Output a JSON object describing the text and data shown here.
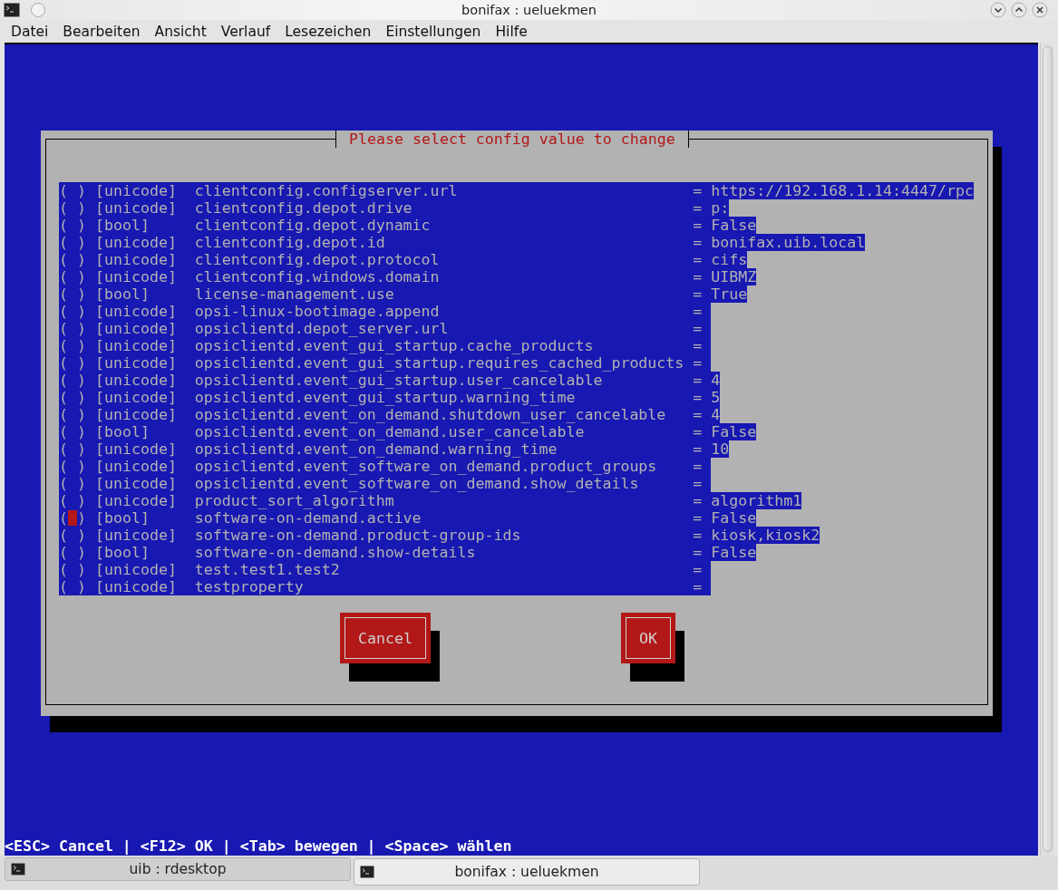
{
  "window": {
    "title": "bonifax : ueluekmen"
  },
  "menu": [
    "Datei",
    "Bearbeiten",
    "Ansicht",
    "Verlauf",
    "Lesezeichen",
    "Einstellungen",
    "Hilfe"
  ],
  "dialog": {
    "title": "Please select config value to change",
    "rows": [
      {
        "radio": "( )",
        "type": "[unicode]",
        "name": "clientconfig.configserver.url",
        "separator": "=",
        "value": "https://192.168.1.14:4447/rpc",
        "checked": false,
        "focused": false
      },
      {
        "radio": "( )",
        "type": "[unicode]",
        "name": "clientconfig.depot.drive",
        "separator": "=",
        "value": "p:",
        "checked": false,
        "focused": false
      },
      {
        "radio": "( )",
        "type": "[bool]",
        "name": "clientconfig.depot.dynamic",
        "separator": "=",
        "value": "False",
        "checked": false,
        "focused": false
      },
      {
        "radio": "( )",
        "type": "[unicode]",
        "name": "clientconfig.depot.id",
        "separator": "=",
        "value": "bonifax.uib.local",
        "checked": false,
        "focused": false
      },
      {
        "radio": "( )",
        "type": "[unicode]",
        "name": "clientconfig.depot.protocol",
        "separator": "=",
        "value": "cifs",
        "checked": false,
        "focused": false
      },
      {
        "radio": "( )",
        "type": "[unicode]",
        "name": "clientconfig.windows.domain",
        "separator": "=",
        "value": "UIBMZ",
        "checked": false,
        "focused": false
      },
      {
        "radio": "( )",
        "type": "[bool]",
        "name": "license-management.use",
        "separator": "=",
        "value": "True",
        "checked": false,
        "focused": false
      },
      {
        "radio": "( )",
        "type": "[unicode]",
        "name": "opsi-linux-bootimage.append",
        "separator": "=",
        "checked": false,
        "focused": false
      },
      {
        "radio": "( )",
        "type": "[unicode]",
        "name": "opsiclientd.depot_server.url",
        "separator": "=",
        "checked": false,
        "focused": false
      },
      {
        "radio": "( )",
        "type": "[unicode]",
        "name": "opsiclientd.event_gui_startup.cache_products",
        "separator": "=",
        "checked": false,
        "focused": false
      },
      {
        "radio": "( )",
        "type": "[unicode]",
        "name": "opsiclientd.event_gui_startup.requires_cached_products",
        "separator": "=",
        "checked": false,
        "focused": false
      },
      {
        "radio": "( )",
        "type": "[unicode]",
        "name": "opsiclientd.event_gui_startup.user_cancelable",
        "separator": "=",
        "value": "4",
        "checked": false,
        "focused": false
      },
      {
        "radio": "( )",
        "type": "[unicode]",
        "name": "opsiclientd.event_gui_startup.warning_time",
        "separator": "=",
        "value": "5",
        "checked": false,
        "focused": false
      },
      {
        "radio": "( )",
        "type": "[unicode]",
        "name": "opsiclientd.event_on_demand.shutdown_user_cancelable",
        "separator": "=",
        "value": "4",
        "checked": false,
        "focused": false
      },
      {
        "radio": "( )",
        "type": "[bool]",
        "name": "opsiclientd.event_on_demand.user_cancelable",
        "separator": "=",
        "value": "False",
        "checked": false,
        "focused": false
      },
      {
        "radio": "( )",
        "type": "[unicode]",
        "name": "opsiclientd.event_on_demand.warning_time",
        "separator": "=",
        "value": "10",
        "checked": false,
        "focused": false
      },
      {
        "radio": "( )",
        "type": "[unicode]",
        "name": "opsiclientd.event_software_on_demand.product_groups",
        "separator": "=",
        "checked": false,
        "focused": false
      },
      {
        "radio": "( )",
        "type": "[unicode]",
        "name": "opsiclientd.event_software_on_demand.show_details",
        "separator": "=",
        "checked": false,
        "focused": false
      },
      {
        "radio": "( )",
        "type": "[unicode]",
        "name": "product_sort_algorithm",
        "separator": "=",
        "value": "algorithm1",
        "checked": false,
        "focused": false
      },
      {
        "radio": "( )",
        "type": "[bool]",
        "name": "software-on-demand.active",
        "separator": "=",
        "value": "False",
        "checked": false,
        "focused": true
      },
      {
        "radio": "( )",
        "type": "[unicode]",
        "name": "software-on-demand.product-group-ids",
        "separator": "=",
        "value": "kiosk,kiosk2",
        "checked": false,
        "focused": false
      },
      {
        "radio": "( )",
        "type": "[bool]",
        "name": "software-on-demand.show-details",
        "separator": "=",
        "value": "False",
        "checked": false,
        "focused": false
      },
      {
        "radio": "( )",
        "type": "[unicode]",
        "name": "test.test1.test2",
        "separator": "=",
        "checked": false,
        "focused": false
      },
      {
        "radio": "( )",
        "type": "[unicode]",
        "name": "testproperty",
        "separator": "=",
        "checked": false,
        "focused": false
      }
    ],
    "buttons": [
      {
        "label": "Cancel"
      },
      {
        "label": "OK"
      }
    ]
  },
  "status_line": "<ESC> Cancel | <F12> OK | <Tab> bewegen | <Space> wählen",
  "taskbar": [
    {
      "label": "uib : rdesktop",
      "selected": false
    },
    {
      "label": "bonifax : ueluekmen",
      "selected": true
    }
  ]
}
